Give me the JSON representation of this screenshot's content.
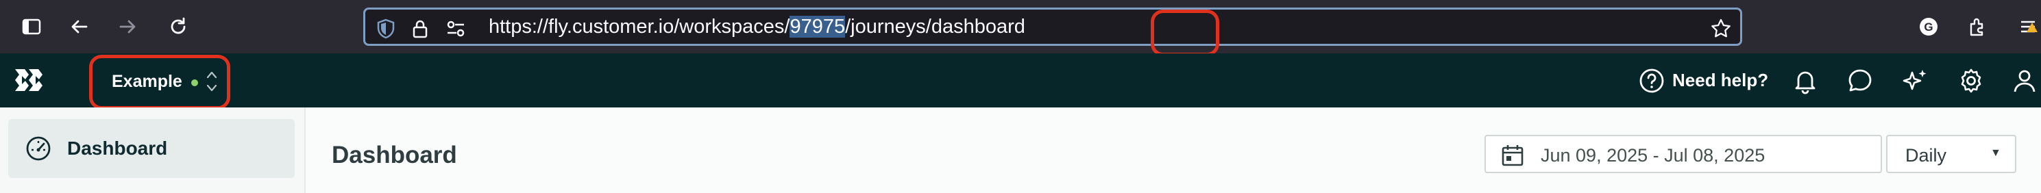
{
  "browser": {
    "url_prefix": "https://fly.customer.io/workspaces/",
    "url_selected": "97975",
    "url_suffix": "/journeys/dashboard",
    "profile_initial": "G"
  },
  "app_nav": {
    "workspace_name": "Example",
    "workspace_status_color": "#8fd16a",
    "help_label": "Need help?",
    "background_color": "#06262a"
  },
  "sidebar": {
    "items": [
      {
        "label": "Dashboard",
        "icon": "gauge-icon",
        "active": true
      }
    ]
  },
  "main": {
    "title": "Dashboard",
    "date_range": "Jun 09, 2025 - Jul 08, 2025",
    "interval": "Daily"
  },
  "colors": {
    "annotation_red": "#e0301e",
    "accent_green": "#8fd16a"
  }
}
